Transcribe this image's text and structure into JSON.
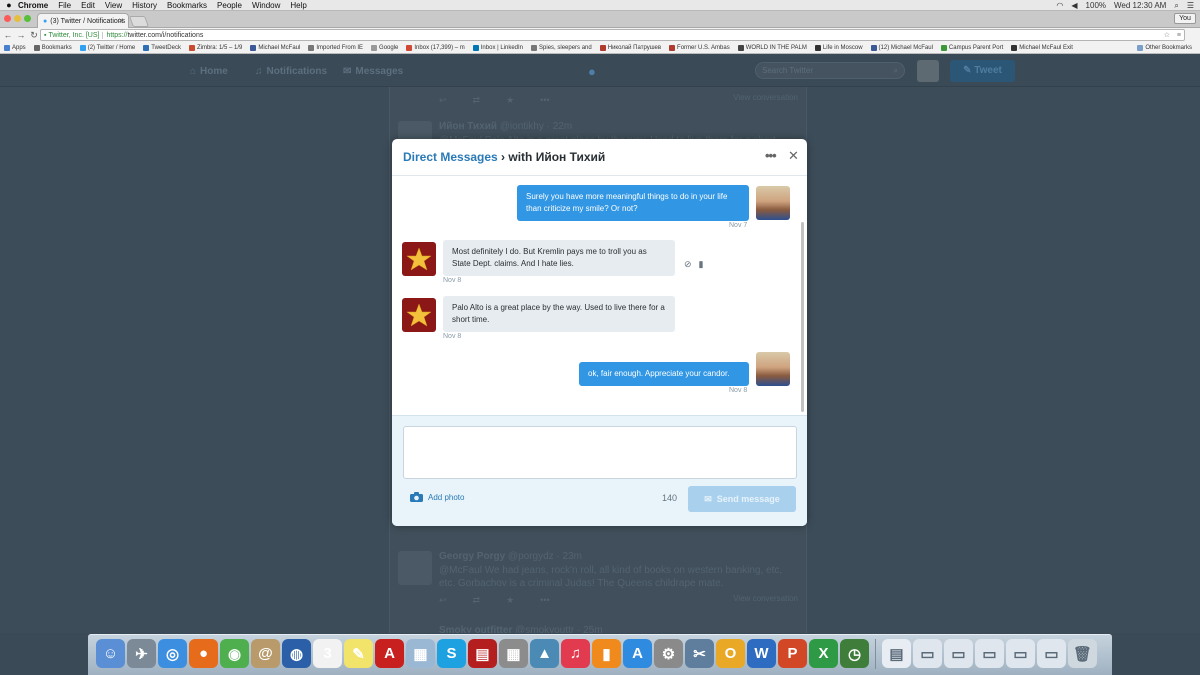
{
  "menubar": {
    "app": "Chrome",
    "items": [
      "File",
      "Edit",
      "View",
      "History",
      "Bookmarks",
      "People",
      "Window",
      "Help"
    ],
    "battery": "100%",
    "clock": "Wed 12:30 AM"
  },
  "browser": {
    "tab_title": "(3) Twitter / Notifications",
    "profile": "You",
    "ev_cert": "Twitter, Inc. [US]",
    "url_scheme": "https://",
    "url_rest": "twitter.com/i/notifications",
    "bookmarks": [
      {
        "label": "Apps",
        "color": "#4a7fd0"
      },
      {
        "label": "Bookmarks",
        "color": "#666666"
      },
      {
        "label": "(2) Twitter / Home",
        "color": "#2ea1f2"
      },
      {
        "label": "TweetDeck",
        "color": "#2c6fb5"
      },
      {
        "label": "Zimbra: 1/5 – 1/9",
        "color": "#c94a2c"
      },
      {
        "label": "Michael McFaul",
        "color": "#3b5998"
      },
      {
        "label": "Imported From IE",
        "color": "#777777"
      },
      {
        "label": "Google",
        "color": "#999999"
      },
      {
        "label": "Inbox (17,399) – m",
        "color": "#d14836"
      },
      {
        "label": "Inbox | LinkedIn",
        "color": "#0077b5"
      },
      {
        "label": "Spies, sleepers and",
        "color": "#777777"
      },
      {
        "label": "Николай Патрушев",
        "color": "#b03a2e"
      },
      {
        "label": "Former U.S. Ambas",
        "color": "#b03a2e"
      },
      {
        "label": "WORLD IN THE PALM",
        "color": "#444444"
      },
      {
        "label": "Life in Moscow",
        "color": "#333333"
      },
      {
        "label": "(12) Michael McFaul",
        "color": "#3b5998"
      },
      {
        "label": "Campus Parent Port",
        "color": "#3a9a3a"
      },
      {
        "label": "Michael McFaul Exit",
        "color": "#333333"
      }
    ],
    "other_bookmarks": "Other Bookmarks"
  },
  "twitter": {
    "nav": {
      "home": "Home",
      "notifications": "Notifications",
      "messages": "Messages",
      "search_placeholder": "Search Twitter",
      "tweet": "Tweet"
    },
    "bg_tweets": [
      {
        "name": "Ийон Тихий",
        "handle": "@iontikhy · 22m",
        "text": "@McFaul Palo Alto is a great place by the way. Used to live there for a short time.",
        "conversation": "View conversation"
      },
      {
        "name": "Georgy Porgy",
        "handle": "@porgydz · 23m",
        "text": "@McFaul We had jeans, rock'n roll, all kind of books on western banking, etc, etc. Gorbachov is a criminal Judas! The Queens childrape mate.",
        "conversation": "View conversation"
      },
      {
        "name": "Smoky outfitter",
        "handle": "@smokyouttr · 25m",
        "text": "",
        "conversation": ""
      }
    ],
    "top_conversation": "View conversation"
  },
  "dm": {
    "title_link": "Direct Messages",
    "title_rest": " › with Ийон Тихий",
    "more_icon": "•••",
    "close_icon": "✕",
    "messages": [
      {
        "dir": "sent",
        "text": "Surely you have more meaningful things to do in your life than criticize my smile? Or not?",
        "time": "Nov 7"
      },
      {
        "dir": "recv",
        "text": "Most definitely I do. But Kremlin pays me to troll you as State Dept. claims. And I hate lies.",
        "time": "Nov 8"
      },
      {
        "dir": "recv",
        "text": "Palo Alto is a great place by the way. Used to live there for a short time.",
        "time": "Nov 8"
      },
      {
        "dir": "sent",
        "text": "ok, fair enough. Appreciate your candor.",
        "time": "Nov 8"
      }
    ],
    "compose": {
      "placeholder": "",
      "add_photo": "Add photo",
      "counter": "140",
      "send": "Send message"
    },
    "colors": {
      "accent": "#2a7ab7",
      "sent_bubble": "#3196e3",
      "recv_bubble": "#e6ecf0",
      "send_disabled": "#a9d1ee"
    }
  },
  "dock": {
    "apps": [
      {
        "name": "finder-icon",
        "glyph": "☺",
        "color": "#5a8fd6"
      },
      {
        "name": "launchpad-icon",
        "glyph": "✈",
        "color": "#7c8a97"
      },
      {
        "name": "safari-icon",
        "glyph": "◎",
        "color": "#3b8ee0"
      },
      {
        "name": "firefox-icon",
        "glyph": "●",
        "color": "#e66b1a"
      },
      {
        "name": "chrome-icon",
        "glyph": "◉",
        "color": "#4fae4e"
      },
      {
        "name": "contacts-icon",
        "glyph": "@",
        "color": "#b99a6a"
      },
      {
        "name": "google-earth-icon",
        "glyph": "◍",
        "color": "#2b5fa8"
      },
      {
        "name": "calendar-icon",
        "glyph": "3",
        "color": "#f2f2f2"
      },
      {
        "name": "stickies-icon",
        "glyph": "✎",
        "color": "#f2e36a"
      },
      {
        "name": "acrobat-icon",
        "glyph": "A",
        "color": "#c8201e"
      },
      {
        "name": "preview-icon",
        "glyph": "▦",
        "color": "#9ab7d4"
      },
      {
        "name": "skype-icon",
        "glyph": "S",
        "color": "#1da1e0"
      },
      {
        "name": "photo-booth-icon",
        "glyph": "▤",
        "color": "#b51e1e"
      },
      {
        "name": "calculator-icon",
        "glyph": "▦",
        "color": "#8c8c8c"
      },
      {
        "name": "iphoto-icon",
        "glyph": "▲",
        "color": "#4a8ab5"
      },
      {
        "name": "itunes-icon",
        "glyph": "♫",
        "color": "#e23a4e"
      },
      {
        "name": "ibooks-icon",
        "glyph": "▮",
        "color": "#f08a1d"
      },
      {
        "name": "app-store-icon",
        "glyph": "A",
        "color": "#2f8be0"
      },
      {
        "name": "system-preferences-icon",
        "glyph": "⚙",
        "color": "#8a8a8a"
      },
      {
        "name": "image-capture-icon",
        "glyph": "✂",
        "color": "#5f7d9c"
      },
      {
        "name": "outlook-icon",
        "glyph": "O",
        "color": "#e9a825"
      },
      {
        "name": "word-icon",
        "glyph": "W",
        "color": "#2d6cc0"
      },
      {
        "name": "powerpoint-icon",
        "glyph": "P",
        "color": "#d24726"
      },
      {
        "name": "excel-icon",
        "glyph": "X",
        "color": "#2f9a45"
      },
      {
        "name": "time-machine-icon",
        "glyph": "◷",
        "color": "#3e7d3a"
      }
    ],
    "docs": [
      {
        "name": "document-icon",
        "glyph": "▤",
        "color": "#e7edf3"
      },
      {
        "name": "window-thumb-icon",
        "glyph": "▭",
        "color": "#dfe6ed"
      },
      {
        "name": "window-thumb-icon",
        "glyph": "▭",
        "color": "#dfe6ed"
      },
      {
        "name": "window-thumb-icon",
        "glyph": "▭",
        "color": "#dfe6ed"
      },
      {
        "name": "window-thumb-icon",
        "glyph": "▭",
        "color": "#dfe6ed"
      },
      {
        "name": "window-thumb-icon",
        "glyph": "▭",
        "color": "#dfe6ed"
      },
      {
        "name": "trash-icon",
        "glyph": "🗑",
        "color": "#cfd8df"
      }
    ]
  }
}
